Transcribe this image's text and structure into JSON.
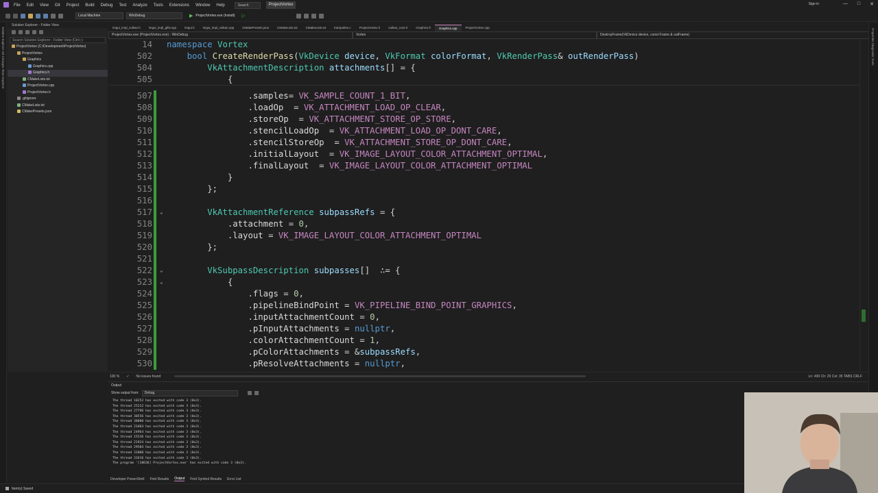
{
  "titlebar": {
    "menu": [
      "File",
      "Edit",
      "View",
      "Git",
      "Project",
      "Build",
      "Debug",
      "Test",
      "Analyze",
      "Tools",
      "Extensions",
      "Window",
      "Help"
    ],
    "search": "Search",
    "project_name": "ProjectVortex",
    "signin": "Sign in"
  },
  "toolbar": {
    "config": "Local Machine",
    "platform": "WinDebug",
    "start_label": "ProjectVortex.exe (Install)"
  },
  "left_strip": "Solution Explorer  Git Changes  Team Explorer",
  "right_strip": "Properties  Diagnostic Tools",
  "solution": {
    "header": "Solution Explorer - Folder View",
    "search_placeholder": "Search Solution Explorer - Folder View (Ctrl+;)",
    "items": [
      {
        "label": "ProjectVortex (C:\\Development\\ProjectVortex)",
        "depth": 0,
        "color": "#c8a45a"
      },
      {
        "label": "ProjectVortex",
        "depth": 1,
        "color": "#c8a45a"
      },
      {
        "label": "Graphics",
        "depth": 2,
        "color": "#c8a45a"
      },
      {
        "label": "Graphics.cpp",
        "depth": 3,
        "color": "#6b9bd1"
      },
      {
        "label": "Graphics.h",
        "depth": 3,
        "color": "#a07bd0",
        "selected": true
      },
      {
        "label": "CMakeLists.txt",
        "depth": 2,
        "color": "#7fb27f"
      },
      {
        "label": "ProjectVortex.cpp",
        "depth": 2,
        "color": "#6b9bd1"
      },
      {
        "label": "ProjectVortex.h",
        "depth": 2,
        "color": "#a07bd0"
      },
      {
        "label": ".gitignore",
        "depth": 1,
        "color": "#888888"
      },
      {
        "label": "CMakeLists.txt",
        "depth": 1,
        "color": "#7fb27f"
      },
      {
        "label": "CMakePresets.json",
        "depth": 1,
        "color": "#d0c060"
      }
    ]
  },
  "tabs": [
    "imgui_impl_vulkan.h",
    "imgui_impl_glfw.cpp",
    "imgui.h",
    "imgui_impl_vulkan.cpp",
    "CMakePresets.json",
    "CMakeLists.txt",
    "CMakeLists.txt",
    "trampoline.c",
    "ProjectVortex.h",
    "vulkan_core.h",
    "Graphics.h",
    "Graphics.cpp",
    "ProjectVortex.cpp"
  ],
  "active_tab": 11,
  "navbar": {
    "project": "ProjectVortex.exe (ProjectVortex.exe) - WinDebug",
    "scope": "Vortex",
    "member": "DestroyFrame(VkDevice device, const Frame & outFrame)"
  },
  "sticky_lines": [
    {
      "num": "14",
      "tokens": [
        [
          "kw",
          "namespace"
        ],
        [
          "",
          ""
        ],
        [
          "ty",
          " Vortex"
        ]
      ]
    },
    {
      "num": "502",
      "tokens": [
        [
          "kw",
          "    bool"
        ],
        [
          "fn",
          " CreateRenderPass"
        ],
        [
          "",
          "("
        ],
        [
          "ty",
          "VkDevice"
        ],
        [
          "pa",
          " device"
        ],
        [
          "",
          ", "
        ],
        [
          "ty",
          "VkFormat"
        ],
        [
          "pa",
          " colorFormat"
        ],
        [
          "",
          ", "
        ],
        [
          "ty",
          "VkRenderPass"
        ],
        [
          "",
          "& "
        ],
        [
          "pa",
          "outRenderPass"
        ],
        [
          "",
          ")"
        ]
      ]
    },
    {
      "num": "504",
      "tokens": [
        [
          "ty",
          "        VkAttachmentDescription"
        ],
        [
          "pa",
          " attachments"
        ],
        [
          "",
          "[] = {"
        ]
      ]
    },
    {
      "num": "505",
      "tokens": [
        [
          "",
          "            {"
        ]
      ]
    }
  ],
  "code_lines": [
    {
      "num": "507",
      "tokens": [
        [
          "",
          "                ."
        ],
        [
          "mb",
          "samples"
        ],
        [
          "",
          ""
        ],
        [
          "",
          ""
        ],
        [
          "",
          ""
        ],
        [
          "",
          ""
        ],
        [
          "",
          ""
        ],
        [
          "",
          "= "
        ],
        [
          "cn",
          "VK_SAMPLE_COUNT_1_BIT"
        ],
        [
          "",
          ","
        ]
      ],
      "change": true
    },
    {
      "num": "508",
      "tokens": [
        [
          "",
          "                ."
        ],
        [
          "mb",
          "loadOp"
        ],
        [
          "",
          ""
        ],
        [
          "",
          ""
        ],
        [
          "",
          ""
        ],
        [
          "",
          ""
        ],
        [
          "",
          ""
        ],
        [
          "",
          ""
        ],
        [
          "",
          ""
        ],
        [
          "",
          ""
        ],
        [
          "",
          ""
        ],
        [
          "",
          ""
        ],
        [
          "",
          ""
        ],
        [
          "",
          ""
        ],
        [
          "",
          ""
        ],
        [
          "",
          ""
        ],
        [
          "",
          "  = "
        ],
        [
          "cn",
          "VK_ATTACHMENT_LOAD_OP_CLEAR"
        ],
        [
          "",
          ","
        ]
      ],
      "change": true
    },
    {
      "num": "509",
      "tokens": [
        [
          "",
          "                ."
        ],
        [
          "mb",
          "storeOp"
        ],
        [
          "",
          ""
        ],
        [
          "",
          "  = "
        ],
        [
          "cn",
          "VK_ATTACHMENT_STORE_OP_STORE"
        ],
        [
          "",
          ","
        ]
      ],
      "change": true
    },
    {
      "num": "510",
      "tokens": [
        [
          "",
          "                ."
        ],
        [
          "mb",
          "stencilLoadOp"
        ],
        [
          "",
          ""
        ],
        [
          "",
          "  = "
        ],
        [
          "cn",
          "VK_ATTACHMENT_LOAD_OP_DONT_CARE"
        ],
        [
          "",
          ","
        ]
      ],
      "change": true
    },
    {
      "num": "511",
      "tokens": [
        [
          "",
          "                ."
        ],
        [
          "mb",
          "stencilStoreOp"
        ],
        [
          "",
          ""
        ],
        [
          "",
          "  = "
        ],
        [
          "cn",
          "VK_ATTACHMENT_STORE_OP_DONT_CARE"
        ],
        [
          "",
          ","
        ]
      ],
      "change": true
    },
    {
      "num": "512",
      "tokens": [
        [
          "",
          "                ."
        ],
        [
          "mb",
          "initialLayout"
        ],
        [
          "",
          ""
        ],
        [
          "",
          "  = "
        ],
        [
          "cn",
          "VK_IMAGE_LAYOUT_COLOR_ATTACHMENT_OPTIMAL"
        ],
        [
          "",
          ","
        ]
      ],
      "change": true
    },
    {
      "num": "513",
      "tokens": [
        [
          "",
          "                ."
        ],
        [
          "mb",
          "finalLayout"
        ],
        [
          "",
          ""
        ],
        [
          "",
          "  = "
        ],
        [
          "cn",
          "VK_IMAGE_LAYOUT_COLOR_ATTACHMENT_OPTIMAL"
        ]
      ],
      "change": true
    },
    {
      "num": "514",
      "tokens": [
        [
          "",
          "            }"
        ]
      ],
      "change": true
    },
    {
      "num": "515",
      "tokens": [
        [
          "",
          "        };"
        ]
      ],
      "change": true
    },
    {
      "num": "516",
      "tokens": [
        [
          "",
          ""
        ]
      ],
      "change": true
    },
    {
      "num": "517",
      "tokens": [
        [
          "ty",
          "        VkAttachmentReference"
        ],
        [
          "pa",
          " subpassRefs"
        ],
        [
          "",
          " = {"
        ]
      ],
      "change": true,
      "fold": true
    },
    {
      "num": "518",
      "tokens": [
        [
          "",
          "            ."
        ],
        [
          "mb",
          "attachment"
        ],
        [
          "",
          " = "
        ],
        [
          "nm",
          "0"
        ],
        [
          "",
          ","
        ]
      ],
      "change": true
    },
    {
      "num": "519",
      "tokens": [
        [
          "",
          "            ."
        ],
        [
          "mb",
          "layout"
        ],
        [
          "",
          " = "
        ],
        [
          "cn",
          "VK_IMAGE_LAYOUT_COLOR_ATTACHMENT_OPTIMAL"
        ]
      ],
      "change": true
    },
    {
      "num": "520",
      "tokens": [
        [
          "",
          "        };"
        ]
      ],
      "change": true
    },
    {
      "num": "521",
      "tokens": [
        [
          "",
          ""
        ]
      ],
      "change": true
    },
    {
      "num": "522",
      "tokens": [
        [
          "ty",
          "        VkSubpassDescription"
        ],
        [
          "pa",
          " subpasses"
        ],
        [
          "",
          "[]  ∴= {"
        ]
      ],
      "change": true,
      "fold": true
    },
    {
      "num": "523",
      "tokens": [
        [
          "",
          "            {"
        ]
      ],
      "change": true,
      "fold": true
    },
    {
      "num": "524",
      "tokens": [
        [
          "",
          "                ."
        ],
        [
          "mb",
          "flags"
        ],
        [
          "",
          " = "
        ],
        [
          "nm",
          "0"
        ],
        [
          "",
          ","
        ]
      ],
      "change": true
    },
    {
      "num": "525",
      "tokens": [
        [
          "",
          "                ."
        ],
        [
          "mb",
          "pipelineBindPoint"
        ],
        [
          "",
          " = "
        ],
        [
          "cn",
          "VK_PIPELINE_BIND_POINT_GRAPHICS"
        ],
        [
          "",
          ","
        ]
      ],
      "change": true
    },
    {
      "num": "526",
      "tokens": [
        [
          "",
          "                ."
        ],
        [
          "mb",
          "inputAttachmentCount"
        ],
        [
          "",
          " = "
        ],
        [
          "nm",
          "0"
        ],
        [
          "",
          ","
        ]
      ],
      "change": true
    },
    {
      "num": "527",
      "tokens": [
        [
          "",
          "                ."
        ],
        [
          "mb",
          "pInputAttachments"
        ],
        [
          "",
          " = "
        ],
        [
          "kw",
          "nullptr"
        ],
        [
          "",
          ","
        ]
      ],
      "change": true
    },
    {
      "num": "528",
      "tokens": [
        [
          "",
          "                ."
        ],
        [
          "mb",
          "colorAttachmentCount"
        ],
        [
          "",
          " = "
        ],
        [
          "nm",
          "1"
        ],
        [
          "",
          ","
        ]
      ],
      "change": true
    },
    {
      "num": "529",
      "tokens": [
        [
          "",
          "                ."
        ],
        [
          "mb",
          "pColorAttachments"
        ],
        [
          "",
          " = &"
        ],
        [
          "pa",
          "subpassRefs"
        ],
        [
          "",
          ","
        ]
      ],
      "change": true
    },
    {
      "num": "530",
      "tokens": [
        [
          "",
          "                ."
        ],
        [
          "mb",
          "pResolveAttachments"
        ],
        [
          "",
          " = "
        ],
        [
          "kw",
          "nullptr"
        ],
        [
          "",
          ","
        ]
      ],
      "change": true
    }
  ],
  "statusline": {
    "zoom": "100 %",
    "issues": "No issues found",
    "position": "Ln: 499   Ch: 29   Col: 35   TABS   CRLF"
  },
  "output": {
    "title": "Output",
    "show_from_label": "Show output from:",
    "source": "Debug",
    "lines": [
      "The thread 10252 has exited with code 3 (0x3).",
      "The thread 25212 has exited with code 3 (0x3).",
      "The thread 27796 has exited with code 3 (0x3).",
      "The thread 30556 has exited with code 3 (0x3).",
      "The thread 30000 has exited with code 3 (0x3).",
      "The thread 23464 has exited with code 3 (0x3).",
      "The thread 24964 has exited with code 3 (0x3).",
      "The thread 15536 has exited with code 3 (0x3).",
      "The thread 21924 has exited with code 3 (0x3).",
      "The thread 29504 has exited with code 3 (0x3).",
      "The thread 31000 has exited with code 3 (0x3).",
      "The thread 31616 has exited with code 3 (0x3).",
      "The program '[18636] ProjectVortex.exe' has exited with code 3 (0x3)."
    ]
  },
  "bottom_tabs": [
    "Developer PowerShell",
    "Find Results",
    "Output",
    "Find Symbol Results",
    "Error List"
  ],
  "bottom_active": 2,
  "footer": {
    "status": "Item(s) Saved"
  }
}
